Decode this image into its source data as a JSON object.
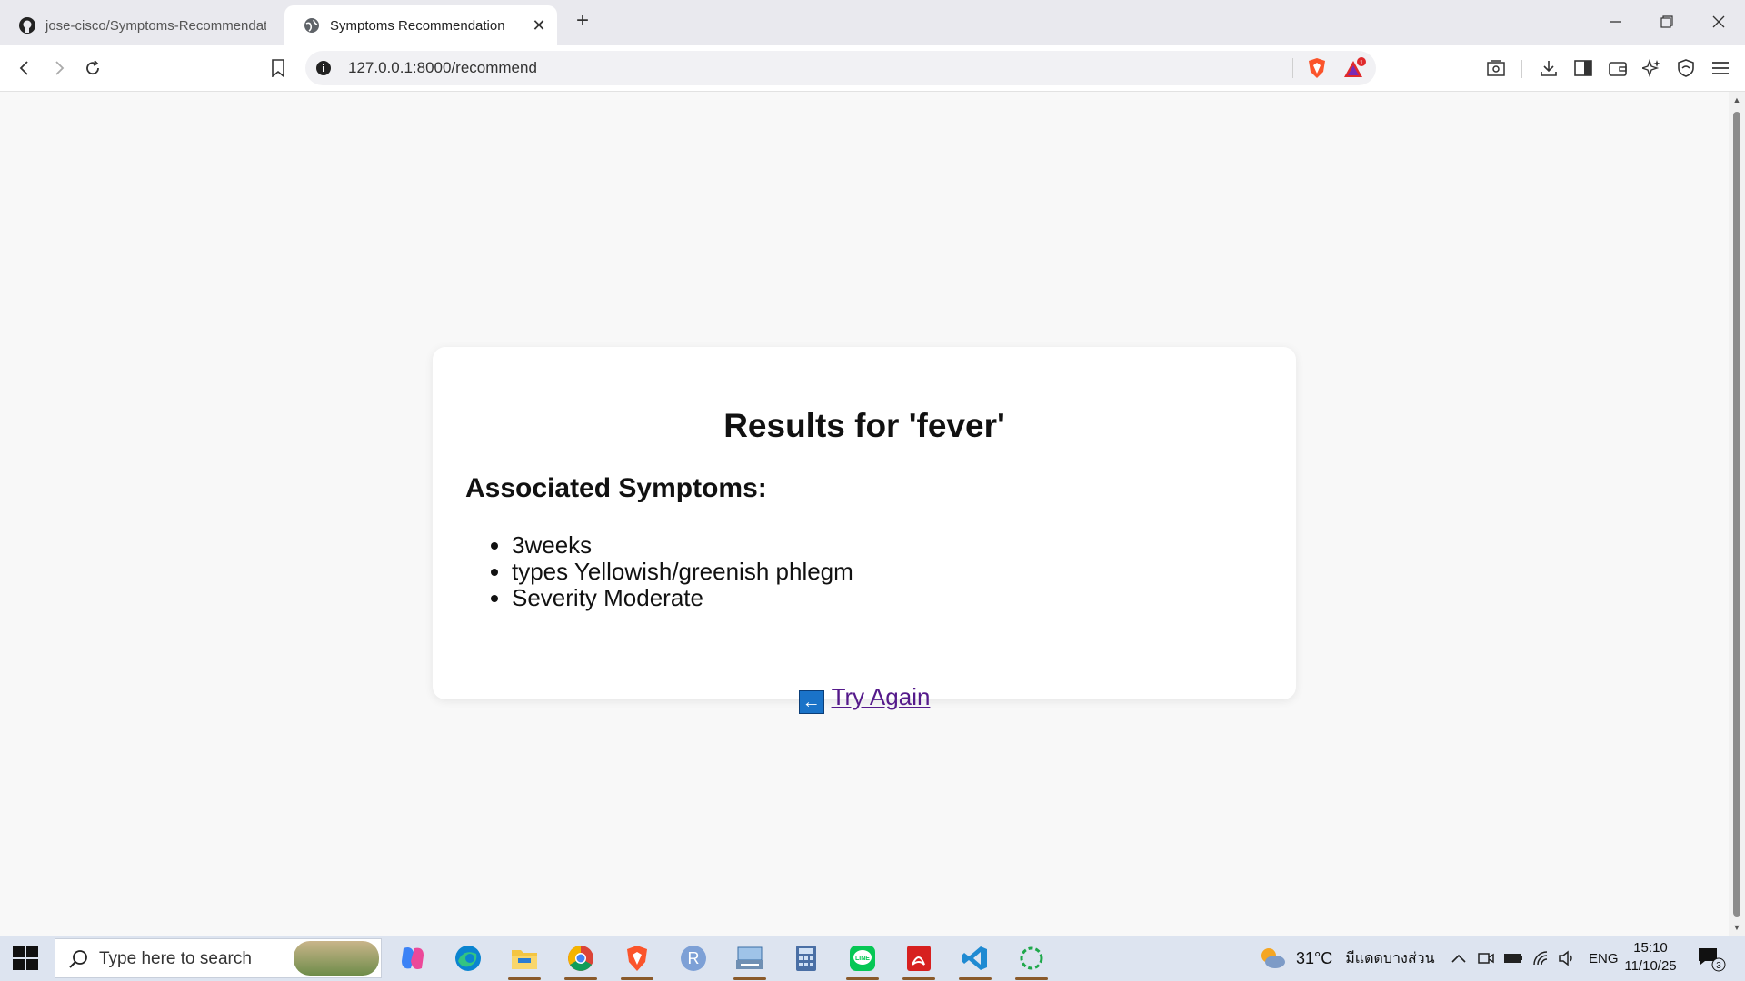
{
  "browser": {
    "tabs": [
      {
        "title": "jose-cisco/Symptoms-Recommendat",
        "active": false,
        "icon": "github-icon"
      },
      {
        "title": "Symptoms Recommendation",
        "active": true,
        "icon": "globe-icon"
      }
    ],
    "url": "127.0.0.1:8000/recommend",
    "rewards_badge": "1"
  },
  "page": {
    "heading": "Results for 'fever'",
    "subheading": "Associated Symptoms:",
    "symptoms": [
      "3weeks",
      "types Yellowish/greenish phlegm",
      "Severity Moderate"
    ],
    "try_again_arrow": "←",
    "try_again_label": "Try Again"
  },
  "taskbar": {
    "search_placeholder": "Type here to search",
    "apps": [
      "copilot-icon",
      "edge-icon",
      "file-explorer-icon",
      "chrome-icon",
      "brave-icon",
      "r-icon",
      "scanner-icon",
      "calculator-icon",
      "line-icon",
      "acrobat-icon",
      "vscode-icon",
      "loading-app-icon"
    ],
    "weather_temp": "31°C",
    "weather_text": "มีแดดบางส่วน",
    "language": "ENG",
    "time": "15:10",
    "date": "11/10/25",
    "notification_count": "3"
  },
  "colors": {
    "link_visited": "#551a8b",
    "taskbar_bg": "#dde4f0",
    "tabstrip_bg": "#e9e9ee"
  }
}
